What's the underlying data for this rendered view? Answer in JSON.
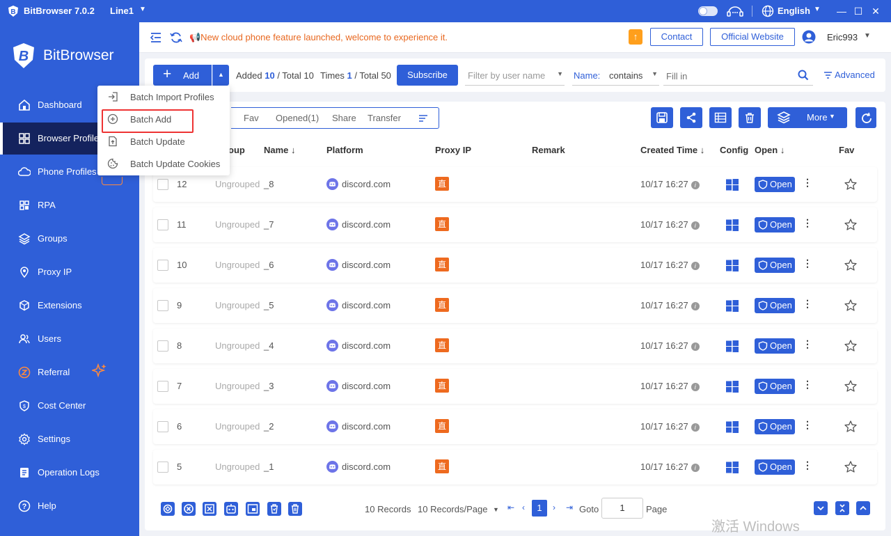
{
  "titlebar": {
    "app_name": "BitBrowser 7.0.2",
    "line": "Line1",
    "language": "English",
    "minimize": "—",
    "maximize": "☐",
    "close": "✕"
  },
  "brand": {
    "name": "BitBrowser"
  },
  "sidebar": {
    "items": [
      {
        "label": "Dashboard",
        "icon": "home-icon"
      },
      {
        "label": "Browser Profile",
        "icon": "grid-icon",
        "active": true
      },
      {
        "label": "Phone Profiles",
        "icon": "cloud-icon"
      },
      {
        "label": "RPA",
        "icon": "rpa-icon"
      },
      {
        "label": "Groups",
        "icon": "layers-icon"
      },
      {
        "label": "Proxy IP",
        "icon": "location-icon"
      },
      {
        "label": "Extensions",
        "icon": "cube-icon"
      },
      {
        "label": "Users",
        "icon": "users-icon"
      },
      {
        "label": "Referral",
        "icon": "referral-icon"
      },
      {
        "label": "Cost Center",
        "icon": "shield-icon"
      },
      {
        "label": "Settings",
        "icon": "gear-icon"
      },
      {
        "label": "Operation Logs",
        "icon": "log-icon"
      },
      {
        "label": "Help",
        "icon": "help-icon"
      }
    ]
  },
  "topbar": {
    "notice": "📢New cloud phone feature launched, welcome to experience it.",
    "contact": "Contact",
    "official_website": "Official Website",
    "username": "Eric993"
  },
  "toolbar": {
    "add_label": "Add",
    "added_label": "Added",
    "added_value": "10",
    "added_total": "/ Total 10",
    "times_label": "Times",
    "times_value": "1",
    "times_total": "/ Total 50",
    "subscribe": "Subscribe",
    "filter_placeholder": "Filter by user name",
    "name_label": "Name:",
    "name_match": "contains",
    "fill_placeholder": "Fill in",
    "advanced": "Advanced"
  },
  "dropdown": {
    "items": [
      {
        "label": "Batch Import Profiles",
        "icon": "import-icon"
      },
      {
        "label": "Batch Add",
        "icon": "plus-circle-icon",
        "highlighted": true
      },
      {
        "label": "Batch Update",
        "icon": "file-up-icon"
      },
      {
        "label": "Batch Update Cookies",
        "icon": "cookie-icon"
      }
    ]
  },
  "tabs": [
    "Fav",
    "Opened(1)",
    "Share",
    "Transfer"
  ],
  "actions": {
    "more": "More"
  },
  "table": {
    "headers": {
      "group": "oup",
      "name": "Name ↓",
      "platform": "Platform",
      "proxy": "Proxy IP",
      "remark": "Remark",
      "created": "Created Time ↓",
      "config": "Config",
      "open": "Open ↓",
      "fav": "Fav"
    },
    "rows": [
      {
        "seq": "12",
        "group": "Ungrouped",
        "name": "_8",
        "platform": "discord.com",
        "proxy": "直",
        "created": "10/17 16:27",
        "open": "Open"
      },
      {
        "seq": "11",
        "group": "Ungrouped",
        "name": "_7",
        "platform": "discord.com",
        "proxy": "直",
        "created": "10/17 16:27",
        "open": "Open"
      },
      {
        "seq": "10",
        "group": "Ungrouped",
        "name": "_6",
        "platform": "discord.com",
        "proxy": "直",
        "created": "10/17 16:27",
        "open": "Open"
      },
      {
        "seq": "9",
        "group": "Ungrouped",
        "name": "_5",
        "platform": "discord.com",
        "proxy": "直",
        "created": "10/17 16:27",
        "open": "Open"
      },
      {
        "seq": "8",
        "group": "Ungrouped",
        "name": "_4",
        "platform": "discord.com",
        "proxy": "直",
        "created": "10/17 16:27",
        "open": "Open"
      },
      {
        "seq": "7",
        "group": "Ungrouped",
        "name": "_3",
        "platform": "discord.com",
        "proxy": "直",
        "created": "10/17 16:27",
        "open": "Open"
      },
      {
        "seq": "6",
        "group": "Ungrouped",
        "name": "_2",
        "platform": "discord.com",
        "proxy": "直",
        "created": "10/17 16:27",
        "open": "Open"
      },
      {
        "seq": "5",
        "group": "Ungrouped",
        "name": "_1",
        "platform": "discord.com",
        "proxy": "直",
        "created": "10/17 16:27",
        "open": "Open"
      }
    ]
  },
  "pager": {
    "records": "10 Records",
    "per_page": "10 Records/Page",
    "current_page": "1",
    "goto": "Goto",
    "goto_value": "1",
    "page": "Page"
  },
  "watermark": "激活 Windows",
  "colors": {
    "primary": "#2f5fd8",
    "sidebar_active": "#14235e",
    "notice": "#e8671f",
    "proxy_badge": "#ee6a1f",
    "highlight": "#e33333"
  }
}
